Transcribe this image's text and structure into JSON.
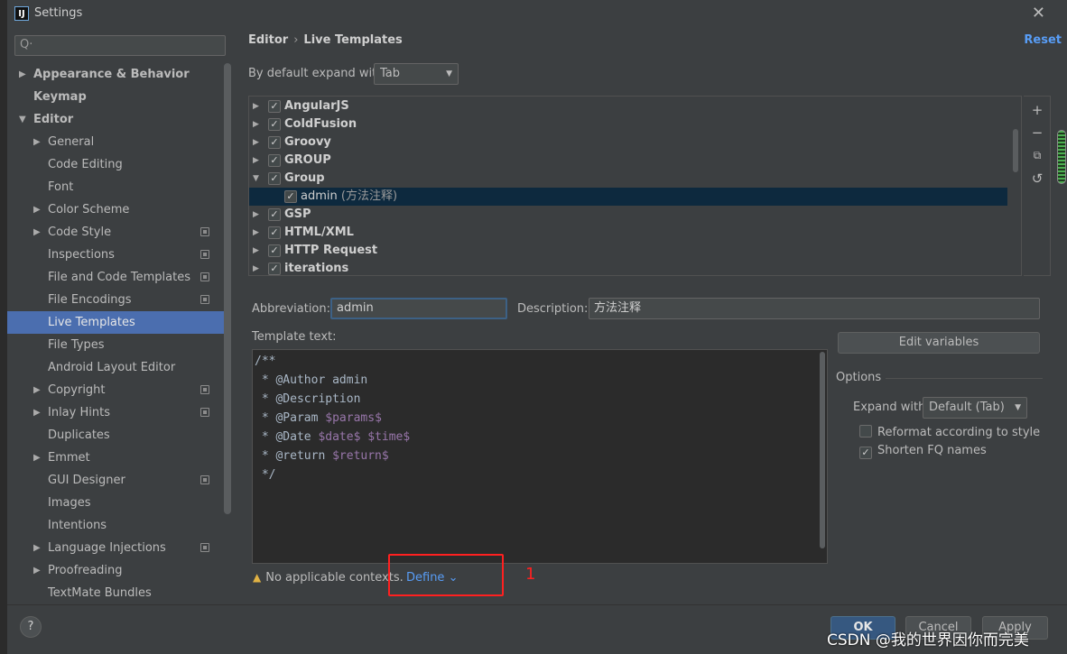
{
  "window": {
    "title": "Settings",
    "logo": "IJ"
  },
  "sidebar": {
    "search_placeholder": "Q·",
    "items": [
      {
        "label": "Appearance & Behavior",
        "arrow": "▶",
        "bold": true
      },
      {
        "label": "Keymap",
        "arrow": "",
        "bold": true
      },
      {
        "label": "Editor",
        "arrow": "▼",
        "bold": true
      },
      {
        "label": "General",
        "arrow": "▶"
      },
      {
        "label": "Code Editing",
        "arrow": ""
      },
      {
        "label": "Font",
        "arrow": ""
      },
      {
        "label": "Color Scheme",
        "arrow": "▶"
      },
      {
        "label": "Code Style",
        "arrow": "▶",
        "proj": true
      },
      {
        "label": "Inspections",
        "arrow": "",
        "proj": true
      },
      {
        "label": "File and Code Templates",
        "arrow": "",
        "proj": true
      },
      {
        "label": "File Encodings",
        "arrow": "",
        "proj": true
      },
      {
        "label": "Live Templates",
        "arrow": "",
        "selected": true
      },
      {
        "label": "File Types",
        "arrow": ""
      },
      {
        "label": "Android Layout Editor",
        "arrow": ""
      },
      {
        "label": "Copyright",
        "arrow": "▶",
        "proj": true
      },
      {
        "label": "Inlay Hints",
        "arrow": "▶",
        "proj": true
      },
      {
        "label": "Duplicates",
        "arrow": ""
      },
      {
        "label": "Emmet",
        "arrow": "▶"
      },
      {
        "label": "GUI Designer",
        "arrow": "",
        "proj": true
      },
      {
        "label": "Images",
        "arrow": ""
      },
      {
        "label": "Intentions",
        "arrow": ""
      },
      {
        "label": "Language Injections",
        "arrow": "▶",
        "proj": true
      },
      {
        "label": "Proofreading",
        "arrow": "▶"
      },
      {
        "label": "TextMate Bundles",
        "arrow": ""
      }
    ]
  },
  "main": {
    "breadcrumb": {
      "parent": "Editor",
      "sep": "›",
      "current": "Live Templates"
    },
    "reset_label": "Reset",
    "expand_label": "By default expand with",
    "expand_value": "Tab",
    "templates": [
      {
        "label": "AngularJS",
        "arrow": "▶",
        "level": 0
      },
      {
        "label": "ColdFusion",
        "arrow": "▶",
        "level": 0
      },
      {
        "label": "Groovy",
        "arrow": "▶",
        "level": 0
      },
      {
        "label": "GROUP",
        "arrow": "▶",
        "level": 0
      },
      {
        "label": "Group",
        "arrow": "▼",
        "level": 0
      },
      {
        "label": "admin",
        "desc": "(方法注释)",
        "arrow": "",
        "level": 1,
        "selected": true
      },
      {
        "label": "GSP",
        "arrow": "▶",
        "level": 0
      },
      {
        "label": "HTML/XML",
        "arrow": "▶",
        "level": 0
      },
      {
        "label": "HTTP Request",
        "arrow": "▶",
        "level": 0
      },
      {
        "label": "iterations",
        "arrow": "▶",
        "level": 0
      }
    ],
    "toolbar": {
      "add": "+",
      "remove": "−",
      "copy": "⧉",
      "restore": "↺"
    },
    "abbreviation_label_a": "Abbreviation:",
    "abbreviation_value": "admin",
    "description_label": "Description:",
    "description_value": "方法注释",
    "template_text_label": "Template text:",
    "template_lines": [
      [
        {
          "t": "/**"
        }
      ],
      [
        {
          "t": " * @Author admin"
        }
      ],
      [
        {
          "t": " * @Description"
        }
      ],
      [
        {
          "t": " * @Param "
        },
        {
          "t": "$params$",
          "v": true
        }
      ],
      [
        {
          "t": " * @Date "
        },
        {
          "t": "$date$",
          "v": true
        },
        {
          "t": " "
        },
        {
          "t": "$time$",
          "v": true
        }
      ],
      [
        {
          "t": " * @return "
        },
        {
          "t": "$return$",
          "v": true
        }
      ],
      [
        {
          "t": " */"
        }
      ]
    ],
    "edit_variables_label": "Edit variables",
    "options_title": "Options",
    "expand_with_label": "Expand with",
    "expand_with_value": "Default (Tab)",
    "reformat_label": "Reformat according to style",
    "reformat_checked": false,
    "shorten_label": "Shorten FQ names",
    "shorten_checked": true,
    "context_warning": "No applicable contexts.",
    "define_label": "Define ⌄",
    "annotation_number": "1"
  },
  "footer": {
    "help": "?",
    "ok_label": "OK",
    "cancel_label": "Cancel",
    "apply_label": "Apply"
  },
  "watermark": "CSDN @我的世界因你而完美",
  "colors": {
    "selection": "#4b6eaf",
    "link": "#589df6",
    "annotation": "#ff2020",
    "template_var": "#9876aa"
  }
}
